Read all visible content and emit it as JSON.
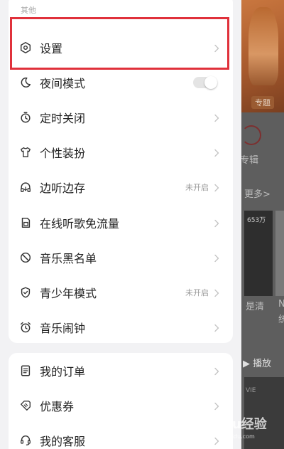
{
  "background": {
    "tag": "专题",
    "album_label": "专辑",
    "more_label": "更多>",
    "count_label": "653万",
    "caption_1": "是清",
    "caption_2": "N",
    "caption_3": "统",
    "play_label": "▶ 播放",
    "vie_label": "VIE"
  },
  "drawer": {
    "section_title": "其他",
    "items": [
      {
        "label": "设置",
        "icon": "settings-hexagon-icon",
        "status": "",
        "control": "chevron"
      },
      {
        "label": "夜间模式",
        "icon": "moon-icon",
        "status": "",
        "control": "toggle"
      },
      {
        "label": "定时关闭",
        "icon": "timer-icon",
        "status": "",
        "control": "chevron"
      },
      {
        "label": "个性装扮",
        "icon": "tshirt-icon",
        "status": "",
        "control": "chevron"
      },
      {
        "label": "边听边存",
        "icon": "headphones-icon",
        "status": "未开启",
        "control": "chevron"
      },
      {
        "label": "在线听歌免流量",
        "icon": "sim-card-icon",
        "status": "",
        "control": "chevron"
      },
      {
        "label": "音乐黑名单",
        "icon": "block-icon",
        "status": "",
        "control": "chevron"
      },
      {
        "label": "青少年模式",
        "icon": "shield-icon",
        "status": "未开启",
        "control": "chevron"
      },
      {
        "label": "音乐闹钟",
        "icon": "alarm-clock-icon",
        "status": "",
        "control": "chevron"
      }
    ],
    "items2": [
      {
        "label": "我的订单",
        "icon": "order-document-icon",
        "control": "chevron"
      },
      {
        "label": "优惠券",
        "icon": "coupon-icon",
        "control": "chevron"
      },
      {
        "label": "我的客服",
        "icon": "customer-service-icon",
        "control": "chevron"
      }
    ]
  },
  "watermark": {
    "text": "Baidu经验",
    "sub": "jingyan.baidu.com"
  },
  "colors": {
    "highlight": "#e0313b",
    "drawer_bg": "#f2f2f4",
    "card_bg": "#ffffff"
  }
}
